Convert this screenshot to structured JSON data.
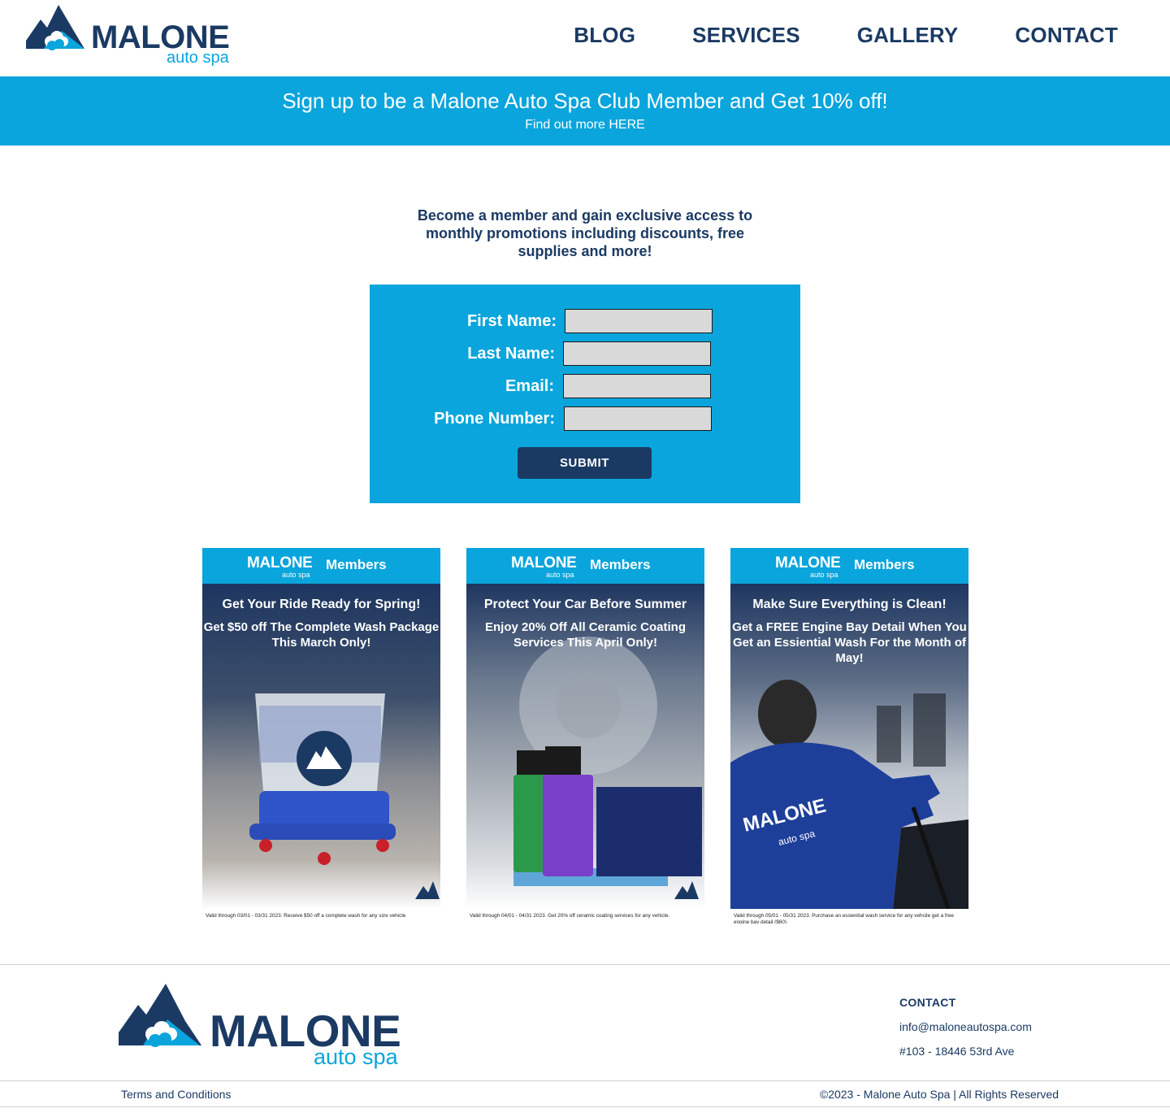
{
  "brand": {
    "name": "MALONE",
    "sub": "auto spa",
    "colors": {
      "navy": "#1b3a63",
      "sky": "#0aa5dc"
    }
  },
  "nav": {
    "items": [
      {
        "label": "BLOG"
      },
      {
        "label": "SERVICES"
      },
      {
        "label": "GALLERY"
      },
      {
        "label": "CONTACT"
      }
    ]
  },
  "banner": {
    "title": "Sign up to be a Malone Auto Spa Club Member and Get 10% off!",
    "link": "Find out more HERE"
  },
  "intro": {
    "text": "Become a member and gain exclusive access to monthly promotions including discounts, free supplies and more!"
  },
  "form": {
    "first_name_label": "First Name:",
    "first_name_value": "",
    "last_name_label": "Last Name:",
    "last_name_value": "",
    "email_label": "Email:",
    "email_value": "",
    "phone_label": "Phone Number:",
    "phone_value": "",
    "submit_label": "SUBMIT"
  },
  "promos": [
    {
      "brand": "MALONE",
      "brand_sub": "auto spa",
      "members": "Members",
      "headline": "Get Your Ride Ready for Spring!",
      "offer": "Get $50 off The Complete Wash Package This March Only!",
      "fine": "Valid through 03/01 - 03/31 2023. Receive $50 off a complete wash for any size vehicle",
      "icon": "wash-bucket-icon"
    },
    {
      "brand": "MALONE",
      "brand_sub": "auto spa",
      "members": "Members",
      "headline": "Protect Your Car Before Summer",
      "offer": "Enjoy 20% Off All Ceramic Coating Services This April Only!",
      "fine": "Valid through 04/01 - 04/31 2023. Get 20% off ceramic coating services for any vehicle.",
      "icon": "ceramic-bottles-icon"
    },
    {
      "brand": "MALONE",
      "brand_sub": "auto spa",
      "members": "Members",
      "headline": "Make Sure Everything is Clean!",
      "offer": "Get a FREE Engine Bay Detail When You Get an Essiential Wash For the Month of May!",
      "fine": "Valid through 05/01 - 05/31 2023. Purchase an essiential wash service for any vehcile get a free engine bay detail ($60)",
      "icon": "detailer-icon"
    }
  ],
  "footer": {
    "contact_title": "CONTACT",
    "email": "info@maloneautospa.com",
    "address": "#103 - 18446 53rd Ave",
    "terms": "Terms and Conditions",
    "copyright": "©2023 - Malone Auto Spa |   All Rights Reserved"
  }
}
